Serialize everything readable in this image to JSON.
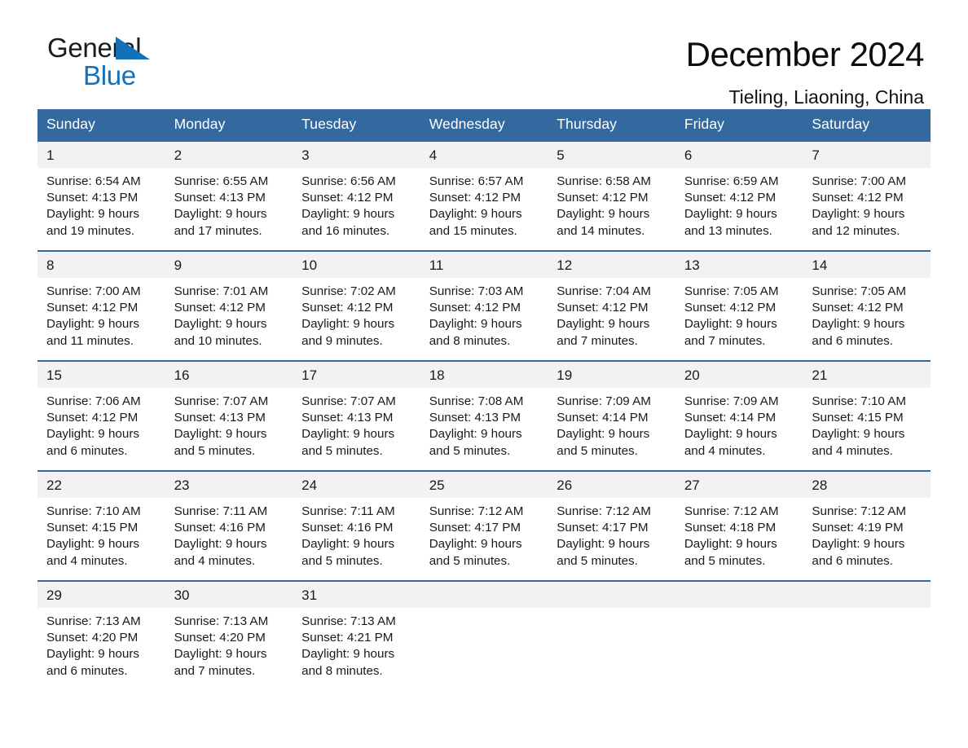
{
  "brand": {
    "name_part1": "General",
    "name_part2": "Blue",
    "triangle_color": "#1371b8"
  },
  "header": {
    "title": "December 2024",
    "subtitle": "Tieling, Liaoning, China"
  },
  "theme": {
    "header_blue": "#33699f",
    "daynum_band": "#f2f2f2",
    "text": "#1a1a1a"
  },
  "weekday_headers": [
    "Sunday",
    "Monday",
    "Tuesday",
    "Wednesday",
    "Thursday",
    "Friday",
    "Saturday"
  ],
  "weeks": [
    [
      {
        "day": "1",
        "sunrise": "Sunrise: 6:54 AM",
        "sunset": "Sunset: 4:13 PM",
        "daylight_line1": "Daylight: 9 hours",
        "daylight_line2": "and 19 minutes."
      },
      {
        "day": "2",
        "sunrise": "Sunrise: 6:55 AM",
        "sunset": "Sunset: 4:13 PM",
        "daylight_line1": "Daylight: 9 hours",
        "daylight_line2": "and 17 minutes."
      },
      {
        "day": "3",
        "sunrise": "Sunrise: 6:56 AM",
        "sunset": "Sunset: 4:12 PM",
        "daylight_line1": "Daylight: 9 hours",
        "daylight_line2": "and 16 minutes."
      },
      {
        "day": "4",
        "sunrise": "Sunrise: 6:57 AM",
        "sunset": "Sunset: 4:12 PM",
        "daylight_line1": "Daylight: 9 hours",
        "daylight_line2": "and 15 minutes."
      },
      {
        "day": "5",
        "sunrise": "Sunrise: 6:58 AM",
        "sunset": "Sunset: 4:12 PM",
        "daylight_line1": "Daylight: 9 hours",
        "daylight_line2": "and 14 minutes."
      },
      {
        "day": "6",
        "sunrise": "Sunrise: 6:59 AM",
        "sunset": "Sunset: 4:12 PM",
        "daylight_line1": "Daylight: 9 hours",
        "daylight_line2": "and 13 minutes."
      },
      {
        "day": "7",
        "sunrise": "Sunrise: 7:00 AM",
        "sunset": "Sunset: 4:12 PM",
        "daylight_line1": "Daylight: 9 hours",
        "daylight_line2": "and 12 minutes."
      }
    ],
    [
      {
        "day": "8",
        "sunrise": "Sunrise: 7:00 AM",
        "sunset": "Sunset: 4:12 PM",
        "daylight_line1": "Daylight: 9 hours",
        "daylight_line2": "and 11 minutes."
      },
      {
        "day": "9",
        "sunrise": "Sunrise: 7:01 AM",
        "sunset": "Sunset: 4:12 PM",
        "daylight_line1": "Daylight: 9 hours",
        "daylight_line2": "and 10 minutes."
      },
      {
        "day": "10",
        "sunrise": "Sunrise: 7:02 AM",
        "sunset": "Sunset: 4:12 PM",
        "daylight_line1": "Daylight: 9 hours",
        "daylight_line2": "and 9 minutes."
      },
      {
        "day": "11",
        "sunrise": "Sunrise: 7:03 AM",
        "sunset": "Sunset: 4:12 PM",
        "daylight_line1": "Daylight: 9 hours",
        "daylight_line2": "and 8 minutes."
      },
      {
        "day": "12",
        "sunrise": "Sunrise: 7:04 AM",
        "sunset": "Sunset: 4:12 PM",
        "daylight_line1": "Daylight: 9 hours",
        "daylight_line2": "and 7 minutes."
      },
      {
        "day": "13",
        "sunrise": "Sunrise: 7:05 AM",
        "sunset": "Sunset: 4:12 PM",
        "daylight_line1": "Daylight: 9 hours",
        "daylight_line2": "and 7 minutes."
      },
      {
        "day": "14",
        "sunrise": "Sunrise: 7:05 AM",
        "sunset": "Sunset: 4:12 PM",
        "daylight_line1": "Daylight: 9 hours",
        "daylight_line2": "and 6 minutes."
      }
    ],
    [
      {
        "day": "15",
        "sunrise": "Sunrise: 7:06 AM",
        "sunset": "Sunset: 4:12 PM",
        "daylight_line1": "Daylight: 9 hours",
        "daylight_line2": "and 6 minutes."
      },
      {
        "day": "16",
        "sunrise": "Sunrise: 7:07 AM",
        "sunset": "Sunset: 4:13 PM",
        "daylight_line1": "Daylight: 9 hours",
        "daylight_line2": "and 5 minutes."
      },
      {
        "day": "17",
        "sunrise": "Sunrise: 7:07 AM",
        "sunset": "Sunset: 4:13 PM",
        "daylight_line1": "Daylight: 9 hours",
        "daylight_line2": "and 5 minutes."
      },
      {
        "day": "18",
        "sunrise": "Sunrise: 7:08 AM",
        "sunset": "Sunset: 4:13 PM",
        "daylight_line1": "Daylight: 9 hours",
        "daylight_line2": "and 5 minutes."
      },
      {
        "day": "19",
        "sunrise": "Sunrise: 7:09 AM",
        "sunset": "Sunset: 4:14 PM",
        "daylight_line1": "Daylight: 9 hours",
        "daylight_line2": "and 5 minutes."
      },
      {
        "day": "20",
        "sunrise": "Sunrise: 7:09 AM",
        "sunset": "Sunset: 4:14 PM",
        "daylight_line1": "Daylight: 9 hours",
        "daylight_line2": "and 4 minutes."
      },
      {
        "day": "21",
        "sunrise": "Sunrise: 7:10 AM",
        "sunset": "Sunset: 4:15 PM",
        "daylight_line1": "Daylight: 9 hours",
        "daylight_line2": "and 4 minutes."
      }
    ],
    [
      {
        "day": "22",
        "sunrise": "Sunrise: 7:10 AM",
        "sunset": "Sunset: 4:15 PM",
        "daylight_line1": "Daylight: 9 hours",
        "daylight_line2": "and 4 minutes."
      },
      {
        "day": "23",
        "sunrise": "Sunrise: 7:11 AM",
        "sunset": "Sunset: 4:16 PM",
        "daylight_line1": "Daylight: 9 hours",
        "daylight_line2": "and 4 minutes."
      },
      {
        "day": "24",
        "sunrise": "Sunrise: 7:11 AM",
        "sunset": "Sunset: 4:16 PM",
        "daylight_line1": "Daylight: 9 hours",
        "daylight_line2": "and 5 minutes."
      },
      {
        "day": "25",
        "sunrise": "Sunrise: 7:12 AM",
        "sunset": "Sunset: 4:17 PM",
        "daylight_line1": "Daylight: 9 hours",
        "daylight_line2": "and 5 minutes."
      },
      {
        "day": "26",
        "sunrise": "Sunrise: 7:12 AM",
        "sunset": "Sunset: 4:17 PM",
        "daylight_line1": "Daylight: 9 hours",
        "daylight_line2": "and 5 minutes."
      },
      {
        "day": "27",
        "sunrise": "Sunrise: 7:12 AM",
        "sunset": "Sunset: 4:18 PM",
        "daylight_line1": "Daylight: 9 hours",
        "daylight_line2": "and 5 minutes."
      },
      {
        "day": "28",
        "sunrise": "Sunrise: 7:12 AM",
        "sunset": "Sunset: 4:19 PM",
        "daylight_line1": "Daylight: 9 hours",
        "daylight_line2": "and 6 minutes."
      }
    ],
    [
      {
        "day": "29",
        "sunrise": "Sunrise: 7:13 AM",
        "sunset": "Sunset: 4:20 PM",
        "daylight_line1": "Daylight: 9 hours",
        "daylight_line2": "and 6 minutes."
      },
      {
        "day": "30",
        "sunrise": "Sunrise: 7:13 AM",
        "sunset": "Sunset: 4:20 PM",
        "daylight_line1": "Daylight: 9 hours",
        "daylight_line2": "and 7 minutes."
      },
      {
        "day": "31",
        "sunrise": "Sunrise: 7:13 AM",
        "sunset": "Sunset: 4:21 PM",
        "daylight_line1": "Daylight: 9 hours",
        "daylight_line2": "and 8 minutes."
      },
      {
        "day": "",
        "sunrise": "",
        "sunset": "",
        "daylight_line1": "",
        "daylight_line2": ""
      },
      {
        "day": "",
        "sunrise": "",
        "sunset": "",
        "daylight_line1": "",
        "daylight_line2": ""
      },
      {
        "day": "",
        "sunrise": "",
        "sunset": "",
        "daylight_line1": "",
        "daylight_line2": ""
      },
      {
        "day": "",
        "sunrise": "",
        "sunset": "",
        "daylight_line1": "",
        "daylight_line2": ""
      }
    ]
  ]
}
